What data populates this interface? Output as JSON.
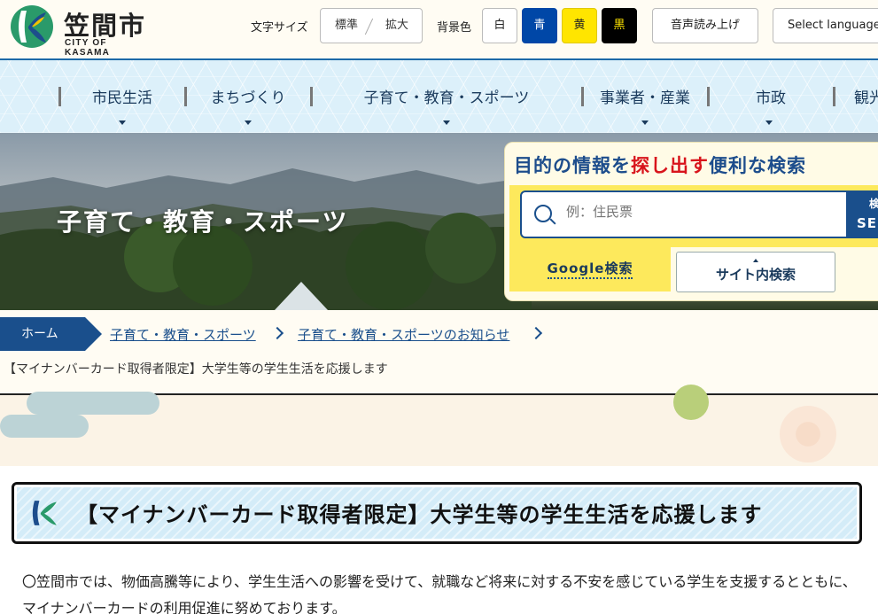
{
  "logo": {
    "name": "笠間市",
    "sub": "CITY OF KASAMA"
  },
  "toolbar": {
    "font_size_label": "文字サイズ",
    "font_standard": "標準",
    "font_large": "拡大",
    "bg_color_label": "背景色",
    "bg_white": "白",
    "bg_blue": "青",
    "bg_yellow": "黄",
    "bg_black": "黒",
    "read_aloud": "音声読み上げ",
    "language": "Select language",
    "colors": {
      "blue": "#0047a7",
      "yellow": "#ffe500",
      "black": "#000000",
      "white": "#ffffff"
    }
  },
  "nav": {
    "items": [
      {
        "label": "市民生活"
      },
      {
        "label": "まちづくり"
      },
      {
        "label": "子育て・教育・スポーツ"
      },
      {
        "label": "事業者・産業"
      },
      {
        "label": "市政"
      },
      {
        "label": "観光"
      }
    ]
  },
  "hero": {
    "title": "子育て・教育・スポーツ"
  },
  "search": {
    "heading_pre": "目的の情報を",
    "heading_em": "探し出す",
    "heading_post": "便利な検索",
    "placeholder": "例：住民票",
    "button_top": "検",
    "button_bottom": "SE",
    "tab_google": "Google検索",
    "tab_site": "サイト内検索"
  },
  "breadcrumb": {
    "home": "ホーム",
    "links": [
      "子育て・教育・スポーツ",
      "子育て・教育・スポーツのお知らせ"
    ],
    "current": "【マイナンバーカード取得者限定】大学生等の学生生活を応援します"
  },
  "page": {
    "title": "【マイナンバーカード取得者限定】大学生等の学生生活を応援します",
    "body": "〇笠間市では、物価高騰等により、学生生活への影響を受けて、就職など将来に対する不安を感じている学生を支援するとともに、マイナンバーカードの利用促進に努めております。"
  },
  "colors": {
    "accent": "#1a4f8c",
    "highlight": "#d8141b",
    "search_bg": "#fde95c",
    "nav_bg": "#dcf0fa"
  }
}
